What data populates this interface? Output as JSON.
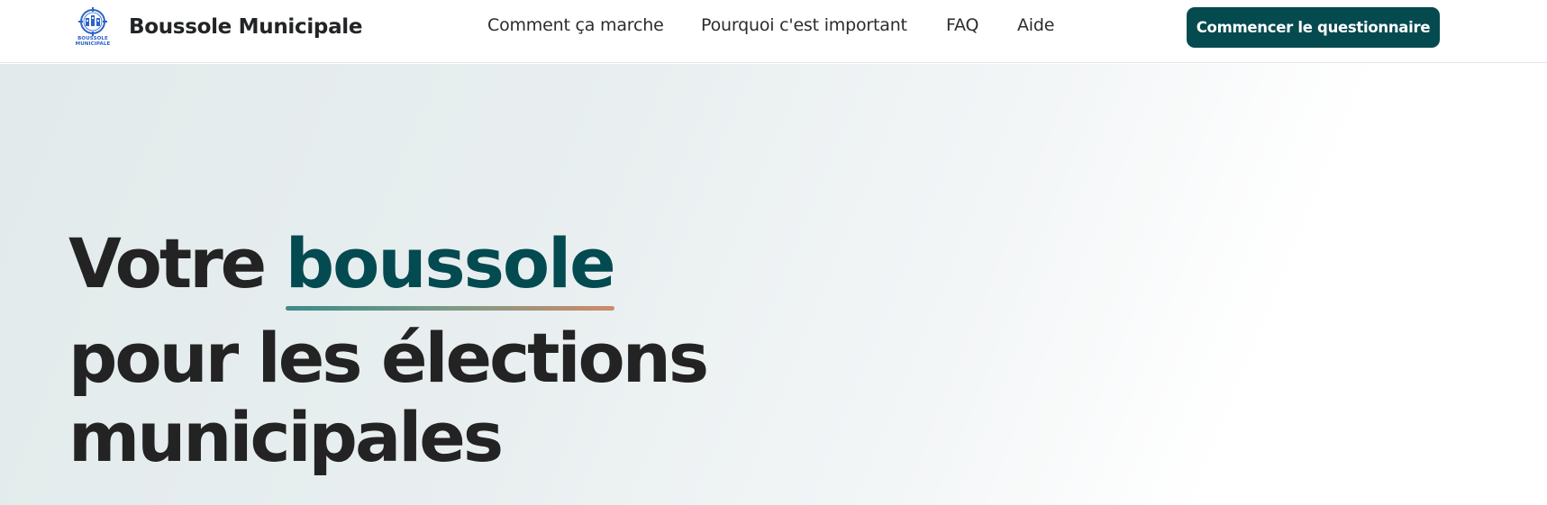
{
  "header": {
    "logo": {
      "line1": "BOUSSOLE",
      "line2": "MUNICIPALE",
      "icon": "compass-city-logo-icon",
      "color": "#2b63c9"
    },
    "brand_name": "Boussole Municipale",
    "nav": [
      {
        "label": "Comment ça marche"
      },
      {
        "label": "Pourquoi c'est important"
      },
      {
        "label": "FAQ"
      },
      {
        "label": "Aide"
      }
    ],
    "cta_label": "Commencer le questionnaire"
  },
  "hero": {
    "headline_part1": "Votre ",
    "headline_accent": "boussole",
    "headline_line2": "pour les élections",
    "headline_line3": "municipales"
  },
  "colors": {
    "primary": "#054a4f",
    "accent_text": "#034b50",
    "headline": "#232323",
    "underline_start": "#3d8a89",
    "underline_end": "#cf8a6a"
  }
}
